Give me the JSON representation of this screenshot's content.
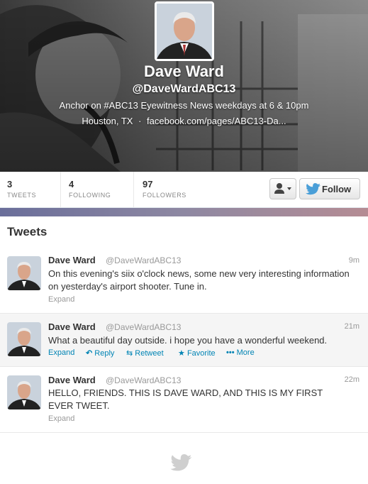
{
  "profile": {
    "name": "Dave Ward",
    "handle": "@DaveWardABC13",
    "bio": "Anchor on #ABC13 Eyewitness News weekdays at 6 & 10pm",
    "location": "Houston, TX",
    "separator": "·",
    "url": "facebook.com/pages/ABC13-Da..."
  },
  "stats": [
    {
      "count": "3",
      "label": "TWEETS"
    },
    {
      "count": "4",
      "label": "FOLLOWING"
    },
    {
      "count": "97",
      "label": "FOLLOWERS"
    }
  ],
  "buttons": {
    "follow": "Follow",
    "user_menu_icon": "user-icon"
  },
  "section_title": "Tweets",
  "tweets": [
    {
      "name": "Dave Ward",
      "handle": "@DaveWardABC13",
      "time": "9m",
      "text": "On this evening's siix o'clock news, some new very interesting information on yesterday's airport shooter.   Tune in.",
      "expand": "Expand"
    },
    {
      "name": "Dave Ward",
      "handle": "@DaveWardABC13",
      "time": "21m",
      "text": "What a beautiful day outside.   i hope you have a wonderful weekend.",
      "expand": "Expand",
      "actions": {
        "reply": "Reply",
        "retweet": "Retweet",
        "favorite": "Favorite",
        "more": "More"
      }
    },
    {
      "name": "Dave Ward",
      "handle": "@DaveWardABC13",
      "time": "22m",
      "text": "HELLO, FRIENDS.   THIS IS DAVE WARD, AND THIS IS MY FIRST EVER TWEET.",
      "expand": "Expand"
    }
  ],
  "colors": {
    "link": "#0084b4",
    "text": "#333333",
    "muted": "#999999",
    "highlight": "#f5f5f5"
  }
}
